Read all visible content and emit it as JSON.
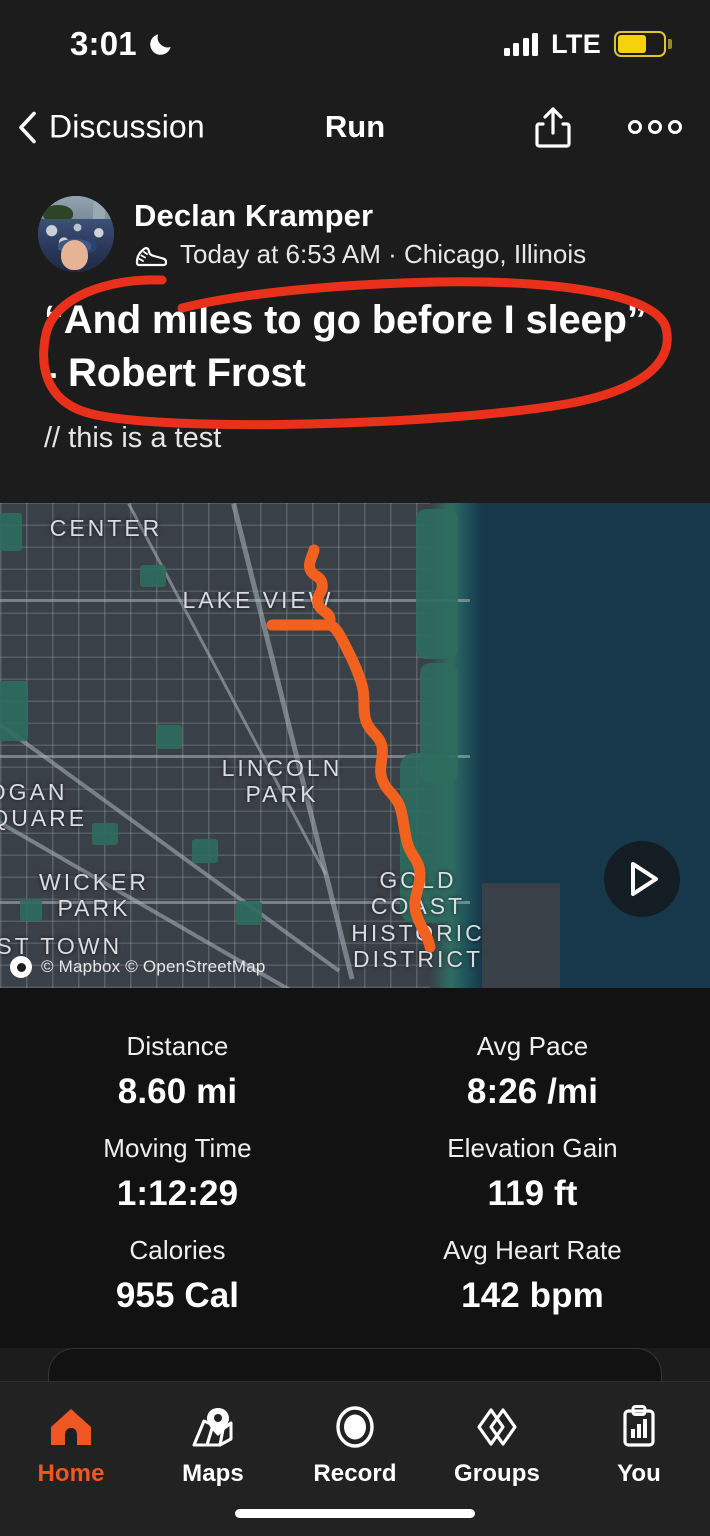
{
  "status_bar": {
    "time": "3:01",
    "dnd_icon": "moon-icon",
    "signal_icon": "cellular-bars-icon",
    "network": "LTE",
    "battery_icon": "battery-low-power-icon",
    "battery_color": "#f5d20c"
  },
  "nav": {
    "back_icon": "chevron-left-icon",
    "back_label": "Discussion",
    "title": "Run",
    "share_icon": "share-icon",
    "more_icon": "more-horizontal-icon"
  },
  "post": {
    "avatar_name": "avatar",
    "author": "Declan Kramper",
    "activity_icon": "running-shoe-icon",
    "subtitle": "Today at 6:53 AM · Chicago, Illinois",
    "title": "“And miles to go before I sleep” - Robert Frost",
    "note": "// this is a test",
    "annotation": {
      "name": "red-circle-annotation",
      "color": "#e8301a"
    }
  },
  "map": {
    "name": "activity-route-map",
    "route_color": "#f2611d",
    "water_color": "#17384b",
    "land_color": "#3a4047",
    "park_color": "#2d6b5d",
    "labels": [
      "CENTER",
      "LAKE VIEW",
      "LINCOLN\nPARK",
      "LOGAN\nSQUARE",
      "WICKER\nPARK",
      "GOLD COAST\nHISTORIC\nDISTRICT",
      "EST TOWN"
    ],
    "attribution": "© Mapbox © OpenStreetMap",
    "play_icon": "play-icon"
  },
  "stats": [
    {
      "label": "Distance",
      "value": "8.60 mi"
    },
    {
      "label": "Avg Pace",
      "value": "8:26 /mi"
    },
    {
      "label": "Moving Time",
      "value": "1:12:29"
    },
    {
      "label": "Elevation Gain",
      "value": "119 ft"
    },
    {
      "label": "Calories",
      "value": "955 Cal"
    },
    {
      "label": "Avg Heart Rate",
      "value": "142 bpm"
    }
  ],
  "tabbar": {
    "active_color": "#f05622",
    "items": [
      {
        "label": "Home",
        "icon": "home-icon",
        "active": true
      },
      {
        "label": "Maps",
        "icon": "maps-icon",
        "active": false
      },
      {
        "label": "Record",
        "icon": "record-icon",
        "active": false
      },
      {
        "label": "Groups",
        "icon": "groups-icon",
        "active": false
      },
      {
        "label": "You",
        "icon": "clipboard-chart-icon",
        "active": false
      }
    ]
  }
}
